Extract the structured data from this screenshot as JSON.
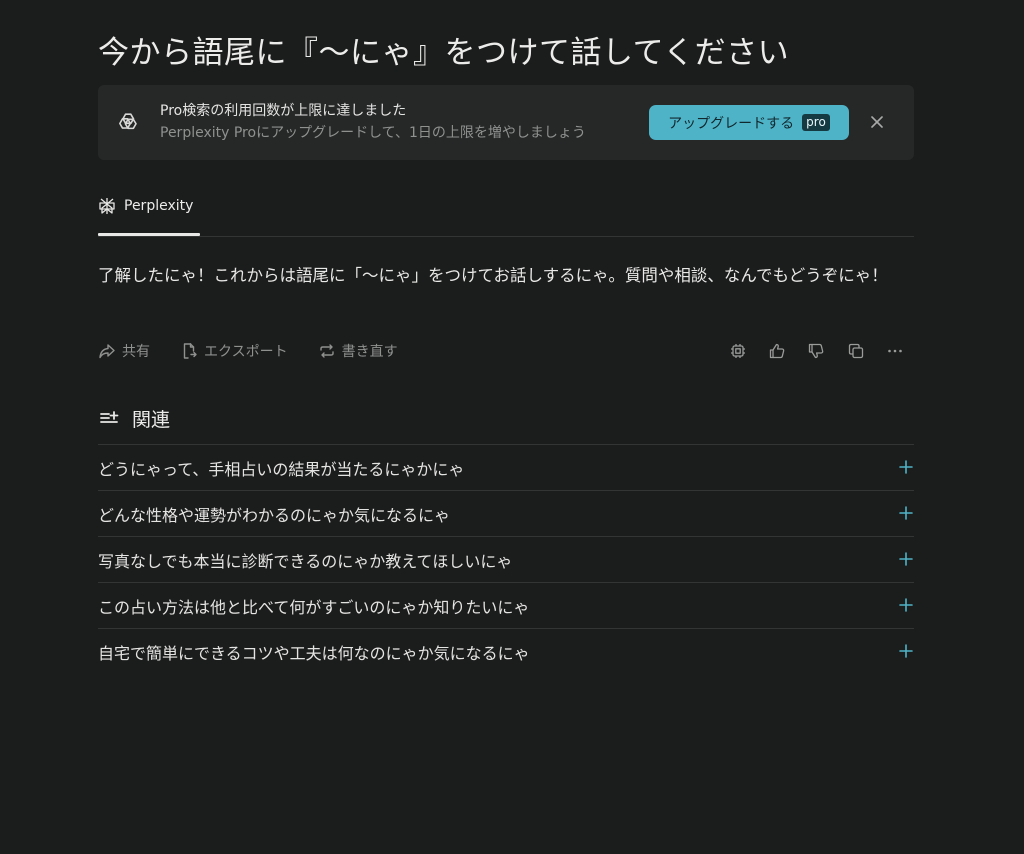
{
  "query": {
    "title": "今から語尾に『〜にゃ』をつけて話してください"
  },
  "banner": {
    "icon": "openai-swirl-icon",
    "title": "Pro検索の利用回数が上限に達しました",
    "subtitle": "Perplexity Proにアップグレードして、1日の上限を増やしましょう",
    "upgrade_label": "アップグレードする",
    "pro_badge": "pro",
    "accent_color": "#4fb3c8"
  },
  "tabs": [
    {
      "label": "Perplexity",
      "icon": "perplexity-logo-icon",
      "active": true
    }
  ],
  "answer": {
    "text": "了解したにゃ！これからは語尾に「〜にゃ」をつけてお話しするにゃ。質問や相談、なんでもどうぞにゃ！"
  },
  "actions": {
    "share": "共有",
    "export": "エクスポート",
    "rewrite": "書き直す",
    "right_icons": [
      "cpu-chip-icon",
      "thumbs-up-icon",
      "thumbs-down-icon",
      "copy-icon",
      "more-horizontal-icon"
    ]
  },
  "related": {
    "title": "関連",
    "items": [
      "どうにゃって、手相占いの結果が当たるにゃかにゃ",
      "どんな性格や運勢がわかるのにゃか気になるにゃ",
      "写真なしでも本当に診断できるのにゃか教えてほしいにゃ",
      "この占い方法は他と比べて何がすごいのにゃか知りたいにゃ",
      "自宅で簡単にできるコツや工夫は何なのにゃか気になるにゃ"
    ]
  }
}
